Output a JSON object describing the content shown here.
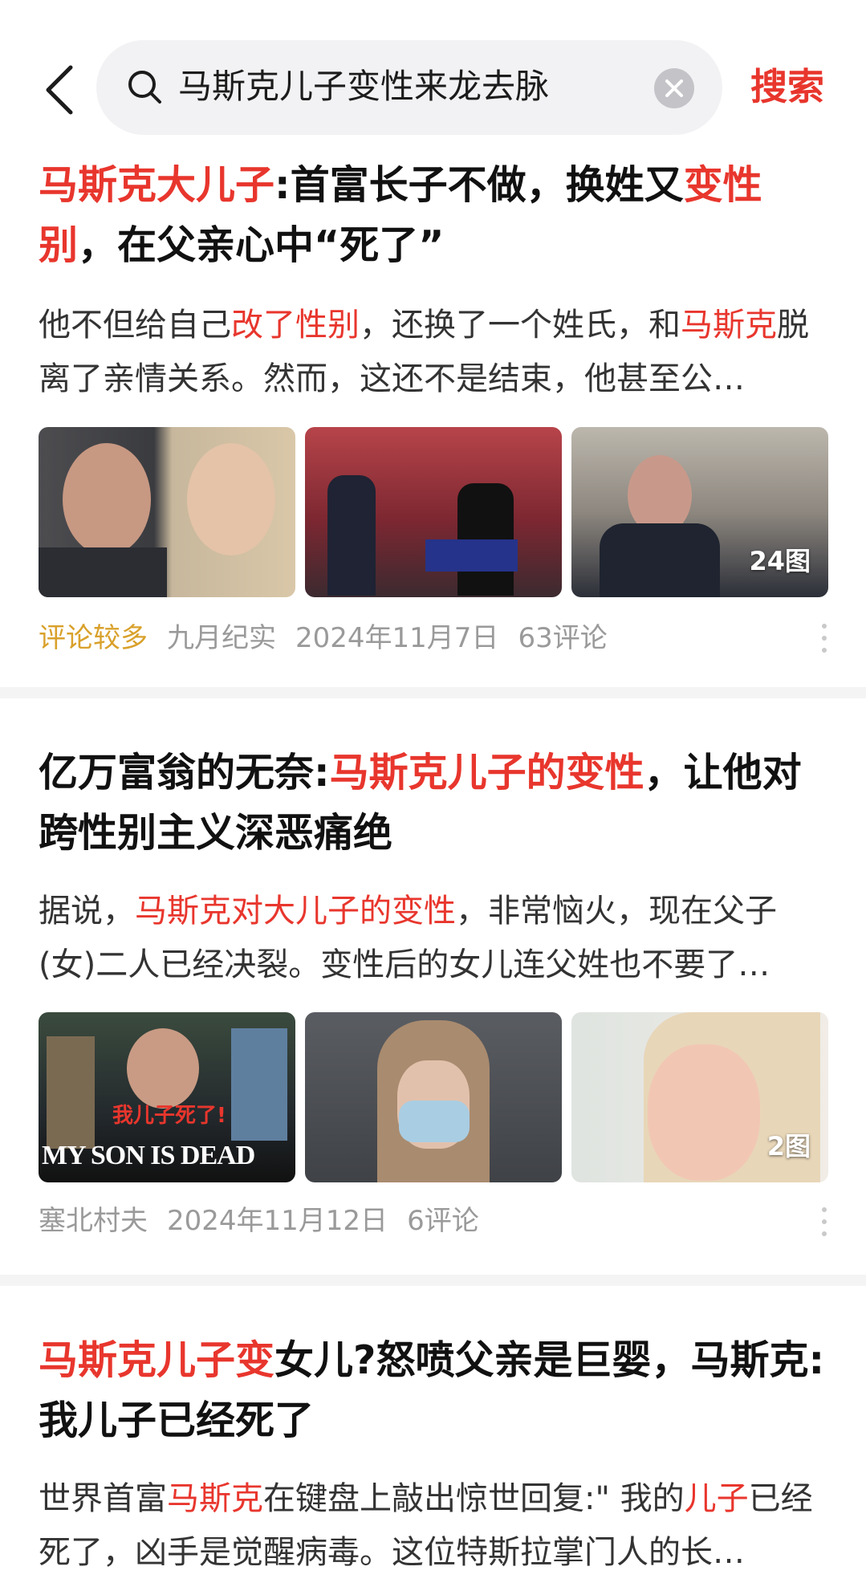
{
  "search": {
    "query": "马斯克儿子变性来龙去脉",
    "button_label": "搜索"
  },
  "colors": {
    "accent": "#e8362d",
    "tag": "#d9a12b",
    "meta": "#9a9a9a"
  },
  "results": [
    {
      "title_parts": [
        {
          "text": "马斯克大儿子",
          "hl": true
        },
        {
          "text": ":首富长子不做，换姓又",
          "hl": false
        },
        {
          "text": "变性别",
          "hl": true
        },
        {
          "text": "，在父亲心中“死了”",
          "hl": false
        }
      ],
      "summary_parts": [
        {
          "text": "他不但给自己",
          "hl": false
        },
        {
          "text": "改了性别",
          "hl": true
        },
        {
          "text": "，还换了一个姓氏，和",
          "hl": false
        },
        {
          "text": "马斯克",
          "hl": true
        },
        {
          "text": "脱离了亲情关系。然而，这还不是结束，他甚至公…",
          "hl": false
        }
      ],
      "image_count": "24图",
      "tag": "评论较多",
      "source": "九月纪实",
      "date": "2024年11月7日",
      "comments": "63评论"
    },
    {
      "title_parts": [
        {
          "text": "亿万富翁的无奈:",
          "hl": false
        },
        {
          "text": "马斯克儿子的变性",
          "hl": true
        },
        {
          "text": "，让他对跨性别主义深恶痛绝",
          "hl": false
        }
      ],
      "summary_parts": [
        {
          "text": "据说，",
          "hl": false
        },
        {
          "text": "马斯克对大儿子的变性",
          "hl": true
        },
        {
          "text": "，非常恼火，现在父子(女)二人已经决裂。变性后的女儿连父姓也不要了…",
          "hl": false
        }
      ],
      "image_caption_cn": "我儿子死了!",
      "image_caption_en": "MY SON IS DEAD",
      "image_count": "2图",
      "source": "塞北村夫",
      "date": "2024年11月12日",
      "comments": "6评论"
    },
    {
      "title_parts": [
        {
          "text": "马斯克儿子变",
          "hl": true
        },
        {
          "text": "女儿?怒喷父亲是巨婴，马斯克:我儿子已经死了",
          "hl": false
        }
      ],
      "summary_parts": [
        {
          "text": "世界首富",
          "hl": false
        },
        {
          "text": "马斯克",
          "hl": true
        },
        {
          "text": "在键盘上敲出惊世回复:\" 我的",
          "hl": false
        },
        {
          "text": "儿子",
          "hl": true
        },
        {
          "text": "已经死了，凶手是觉醒病毒。这位特斯拉掌门人的长…",
          "hl": false
        }
      ]
    }
  ]
}
